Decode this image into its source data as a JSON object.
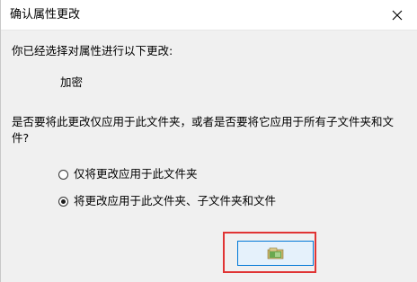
{
  "dialog": {
    "title": "确认属性更改",
    "intro": "你已经选择对属性进行以下更改:",
    "attribute": "加密",
    "question": "是否要将此更改仅应用于此文件夹，或者是否要将它应用于所有子文件夹和文件?",
    "options": [
      {
        "label": "仅将更改应用于此文件夹",
        "checked": false
      },
      {
        "label": "将更改应用于此文件夹、子文件夹和文件",
        "checked": true
      }
    ],
    "ok_label": "",
    "highlight_color": "#e03434",
    "accent_color": "#0078d7"
  },
  "icons": {
    "close": "close-icon",
    "ok_glyph": "folder-icon"
  }
}
